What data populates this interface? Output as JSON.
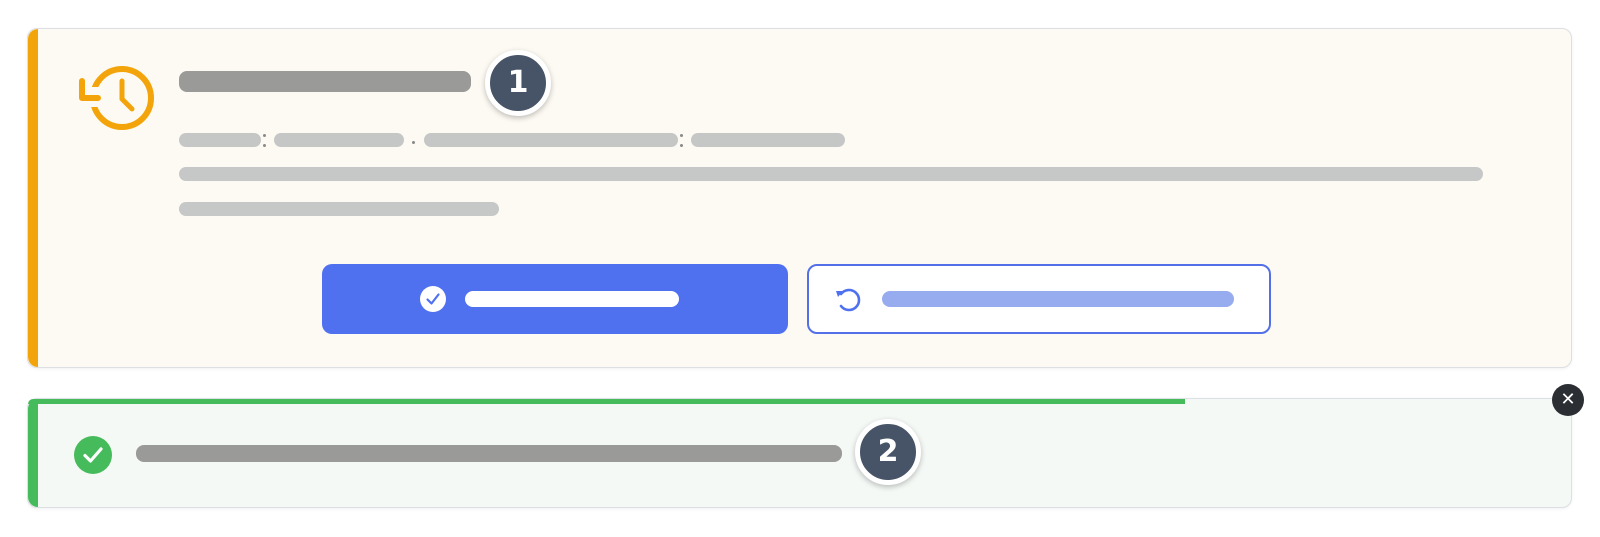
{
  "session_restore_card": {
    "icon": "history-icon",
    "accent_color": "#f4a40b",
    "step_marker": "1",
    "primary_action": {
      "icon": "check-circle-icon",
      "color": "#4f71f0"
    },
    "secondary_action": {
      "icon": "undo-icon",
      "color": "#5470e8"
    }
  },
  "success_toast": {
    "icon": "check-circle-icon",
    "accent_color": "#46bb5b",
    "step_marker": "2",
    "progress": 0.75,
    "close_icon": "close-icon",
    "close_glyph": "✕"
  }
}
